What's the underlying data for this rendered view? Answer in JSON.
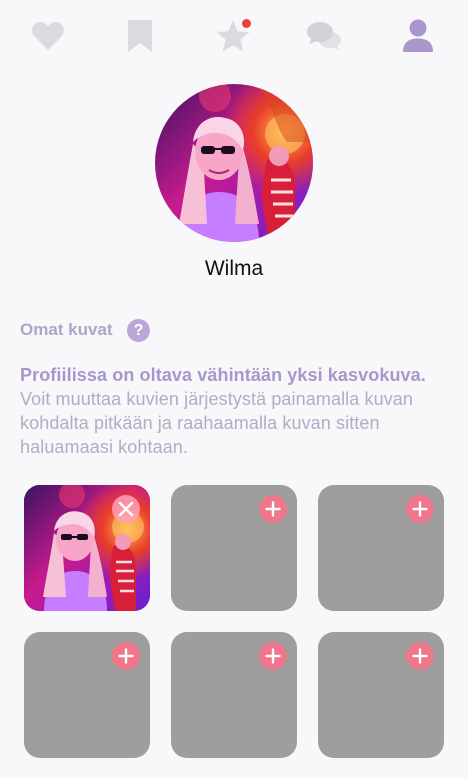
{
  "nav": {
    "items": [
      {
        "name": "nav-likes",
        "icon": "heart-icon",
        "active": false
      },
      {
        "name": "nav-saved",
        "icon": "bookmark-icon",
        "active": false
      },
      {
        "name": "nav-favorites",
        "icon": "star-icon",
        "active": false,
        "has_notification": true
      },
      {
        "name": "nav-messages",
        "icon": "chat-bubbles-icon",
        "active": false
      },
      {
        "name": "nav-profile",
        "icon": "person-icon",
        "active": true
      }
    ]
  },
  "profile": {
    "name": "Wilma",
    "avatar_icon": "profile-photo"
  },
  "photos_section": {
    "title": "Omat kuvat",
    "help_label": "?",
    "info_strong": "Profiilissa on oltava vähintään yksi kasvokuva.",
    "info_text": " Voit muuttaa kuvien järjestystä painamalla kuvan kohdalta pitkään ja raahaamalla kuvan sitten haluamaasi kohtaan.",
    "slots": [
      {
        "filled": true,
        "action_icon": "remove-icon"
      },
      {
        "filled": false,
        "action_icon": "add-icon"
      },
      {
        "filled": false,
        "action_icon": "add-icon"
      },
      {
        "filled": false,
        "action_icon": "add-icon"
      },
      {
        "filled": false,
        "action_icon": "add-icon"
      },
      {
        "filled": false,
        "action_icon": "add-icon"
      }
    ]
  },
  "colors": {
    "inactive_icon": "#dcdadf",
    "active_icon": "#a996cc",
    "notification": "#e9413d",
    "add_button": "#f0768b",
    "empty_slot": "#9e9e9e"
  }
}
